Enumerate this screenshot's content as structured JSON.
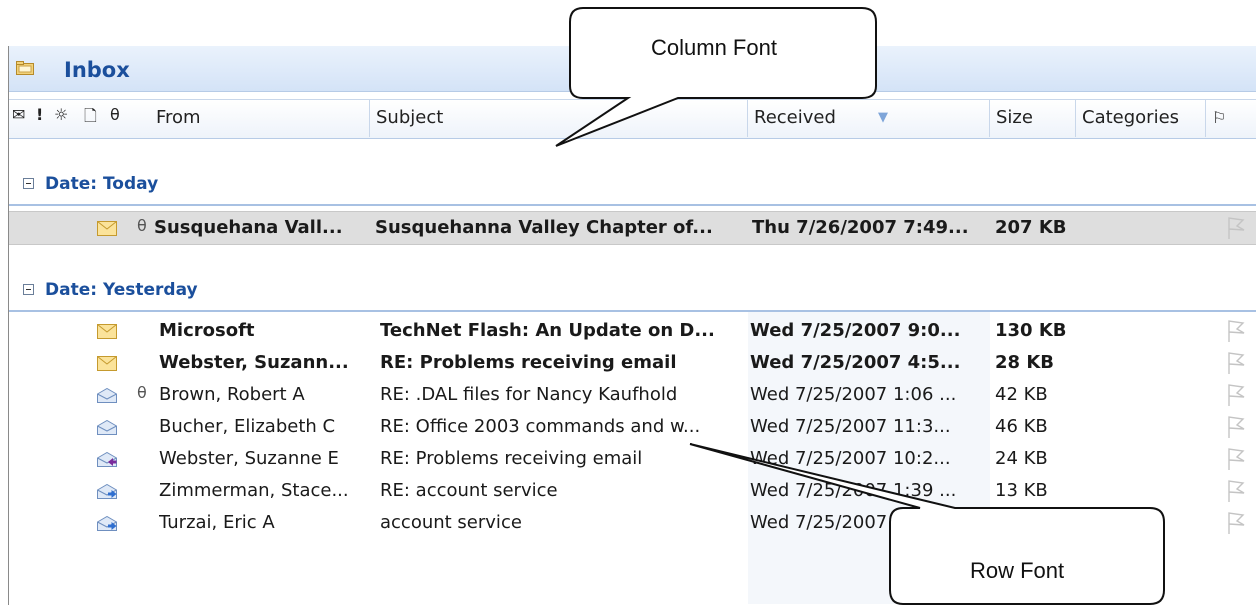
{
  "folder": {
    "title": "Inbox"
  },
  "columns": {
    "header_icons": [
      "envelope-icon",
      "importance-icon",
      "reminder-icon",
      "document-icon",
      "attachment-icon"
    ],
    "from": "From",
    "subject": "Subject",
    "received": "Received",
    "size": "Size",
    "categories": "Categories"
  },
  "groups": [
    {
      "label": "Date: Today",
      "messages": [
        {
          "from": "Susquehana Vall...",
          "subject": "Susquehanna Valley Chapter of...",
          "received": "Thu 7/26/2007 7:49...",
          "size": "207 KB",
          "unread": true,
          "attachment": true,
          "icon": "envelope-icon"
        }
      ]
    },
    {
      "label": "Date: Yesterday",
      "messages": [
        {
          "from": "Microsoft",
          "subject": "TechNet Flash: An Update on D...",
          "received": "Wed 7/25/2007 9:0...",
          "size": "130 KB",
          "unread": true,
          "attachment": false,
          "icon": "envelope-icon"
        },
        {
          "from": "Webster, Suzann...",
          "subject": "RE: Problems receiving email",
          "received": "Wed 7/25/2007 4:5...",
          "size": "28 KB",
          "unread": true,
          "attachment": false,
          "icon": "envelope-icon"
        },
        {
          "from": "Brown, Robert A",
          "subject": "RE: .DAL files for Nancy Kaufhold",
          "received": "Wed 7/25/2007 1:06 ...",
          "size": "42 KB",
          "unread": false,
          "attachment": true,
          "icon": "open-envelope-icon"
        },
        {
          "from": "Bucher, Elizabeth C",
          "subject": "RE: Office 2003 commands and w...",
          "received": "Wed 7/25/2007 11:3...",
          "size": "46 KB",
          "unread": false,
          "attachment": false,
          "icon": "open-envelope-icon"
        },
        {
          "from": "Webster, Suzanne E",
          "subject": "RE: Problems receiving email",
          "received": "Wed 7/25/2007 10:2...",
          "size": "24 KB",
          "unread": false,
          "attachment": false,
          "icon": "replied-envelope-icon"
        },
        {
          "from": "Zimmerman, Stace...",
          "subject": "RE: account service",
          "received": "Wed 7/25/2007 1:39 ...",
          "size": "13 KB",
          "unread": false,
          "attachment": false,
          "icon": "forwarded-envelope-icon"
        },
        {
          "from": "Turzai, Eric A",
          "subject": "account service",
          "received": "Wed 7/25/2007 ...",
          "size": "",
          "unread": false,
          "attachment": false,
          "icon": "forwarded-envelope-icon"
        }
      ]
    }
  ],
  "callouts": [
    {
      "text": "Column Font"
    },
    {
      "text": "Row Font"
    }
  ],
  "colors": {
    "group_label": "#1b4f9c",
    "header_bg": "#d4e3f7",
    "selected_row": "#dedede"
  }
}
